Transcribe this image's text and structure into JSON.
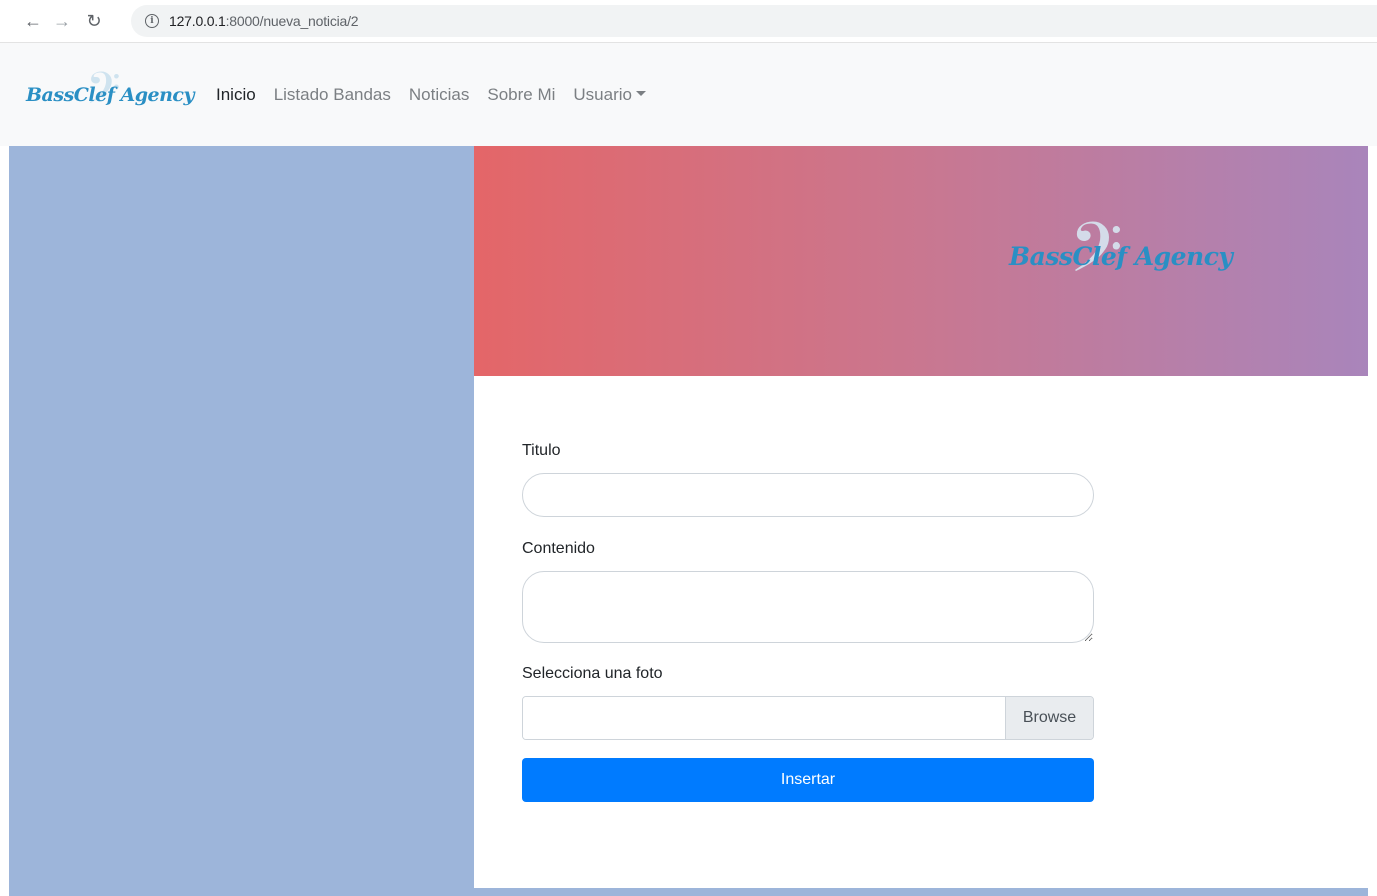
{
  "browser": {
    "back_icon": "arrow-left-icon",
    "forward_icon": "arrow-right-icon",
    "reload_icon": "reload-icon",
    "url_host": "127.0.0.1",
    "url_path": ":8000/nueva_noticia/2"
  },
  "navbar": {
    "brand": "BassClef Agency",
    "links": [
      {
        "label": "Inicio",
        "active": true
      },
      {
        "label": "Listado Bandas",
        "active": false
      },
      {
        "label": "Noticias",
        "active": false
      },
      {
        "label": "Sobre Mi",
        "active": false
      }
    ],
    "user_menu_label": "Usuario"
  },
  "hero": {
    "logo_text": "BassClef Agency",
    "gradient": [
      "#e46668",
      "#a985bb"
    ]
  },
  "form": {
    "title_label": "Titulo",
    "title_value": "",
    "content_label": "Contenido",
    "content_value": "",
    "photo_label": "Selecciona una foto",
    "browse_label": "Browse",
    "submit_label": "Insertar"
  },
  "colors": {
    "side_panel": "#9db5da",
    "primary_button": "#007bff",
    "brand_text": "#2a8fc4"
  }
}
